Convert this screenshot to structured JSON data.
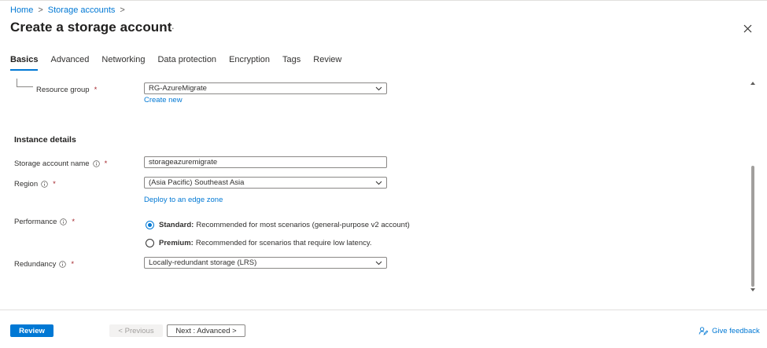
{
  "breadcrumb": {
    "home": "Home",
    "storage_accounts": "Storage accounts",
    "separator": ">"
  },
  "header": {
    "title": "Create a storage account",
    "more": "···"
  },
  "tabs": [
    {
      "label": "Basics",
      "active": true
    },
    {
      "label": "Advanced",
      "active": false
    },
    {
      "label": "Networking",
      "active": false
    },
    {
      "label": "Data protection",
      "active": false
    },
    {
      "label": "Encryption",
      "active": false
    },
    {
      "label": "Tags",
      "active": false
    },
    {
      "label": "Review",
      "active": false
    }
  ],
  "form": {
    "resource_group": {
      "label": "Resource group",
      "required": "*",
      "value": "RG-AzureMigrate",
      "create_new": "Create new"
    },
    "instance_details_title": "Instance details",
    "storage_account_name": {
      "label": "Storage account name",
      "required": "*",
      "value": "storageazuremigrate"
    },
    "region": {
      "label": "Region",
      "required": "*",
      "value": "(Asia Pacific) Southeast Asia",
      "edge_zone_link": "Deploy to an edge zone"
    },
    "performance": {
      "label": "Performance",
      "required": "*",
      "options": [
        {
          "title": "Standard:",
          "description": "Recommended for most scenarios (general-purpose v2 account)",
          "selected": true
        },
        {
          "title": "Premium:",
          "description": "Recommended for scenarios that require low latency.",
          "selected": false
        }
      ]
    },
    "redundancy": {
      "label": "Redundancy",
      "required": "*",
      "value": "Locally-redundant storage (LRS)"
    }
  },
  "footer": {
    "review": "Review",
    "previous": "< Previous",
    "next": "Next : Advanced >",
    "feedback": "Give feedback"
  },
  "colors": {
    "accent": "#0078d4",
    "required": "#a4262c",
    "text": "#323130",
    "border": "#8a8886"
  }
}
